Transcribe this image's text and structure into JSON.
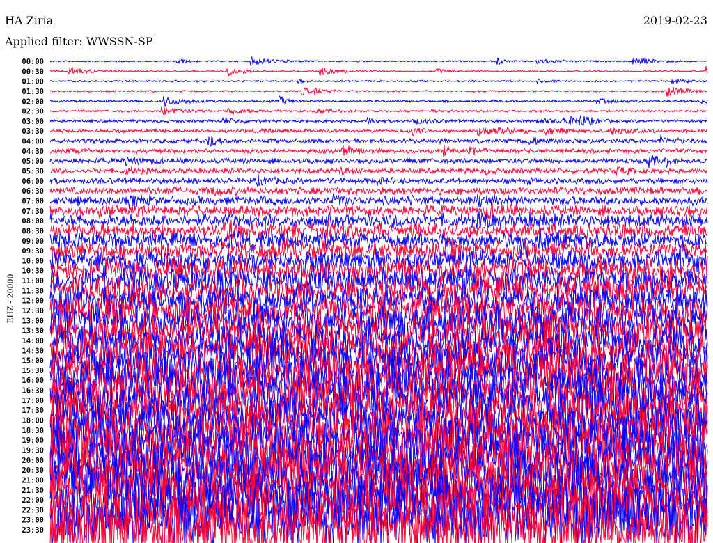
{
  "header": {
    "station": "HA Ziria",
    "date": "2019-02-23",
    "filter": "Applied filter: WWSSN-SP"
  },
  "chart_data": {
    "type": "line",
    "title": "HA Ziria",
    "subtitle": "Applied filter: WWSSN-SP",
    "ylabel": "EHZ - 20000",
    "xlabel": "",
    "row_labels": [
      "00:00",
      "00:30",
      "01:00",
      "01:30",
      "02:00",
      "02:30",
      "03:00",
      "03:30",
      "04:00",
      "04:30",
      "05:00",
      "05:30",
      "06:00",
      "06:30",
      "07:00",
      "07:30",
      "08:00",
      "08:30",
      "09:00",
      "09:30",
      "10:00",
      "10:30",
      "11:00",
      "11:30",
      "12:00",
      "12:30",
      "13:00",
      "13:30",
      "14:00",
      "14:30",
      "15:00",
      "15:30",
      "16:00",
      "16:30",
      "17:00",
      "17:30",
      "18:00",
      "18:30",
      "19:00",
      "19:30",
      "20:00",
      "20:30",
      "21:00",
      "21:30",
      "22:00",
      "22:30",
      "23:00",
      "23:30"
    ],
    "series_colors": [
      "#0000ff",
      "#ff0033"
    ],
    "relative_amplitude": [
      1,
      1,
      1.2,
      1.2,
      1.5,
      1.5,
      2,
      2.2,
      3,
      3,
      3.5,
      3.5,
      4,
      5,
      6,
      7,
      9,
      10,
      11,
      12,
      14,
      15,
      17,
      18,
      20,
      21,
      22,
      23,
      24,
      25,
      26,
      27,
      28,
      28,
      29,
      30,
      30,
      31,
      32,
      32,
      33,
      33,
      34,
      34,
      35,
      36,
      38,
      40
    ]
  }
}
